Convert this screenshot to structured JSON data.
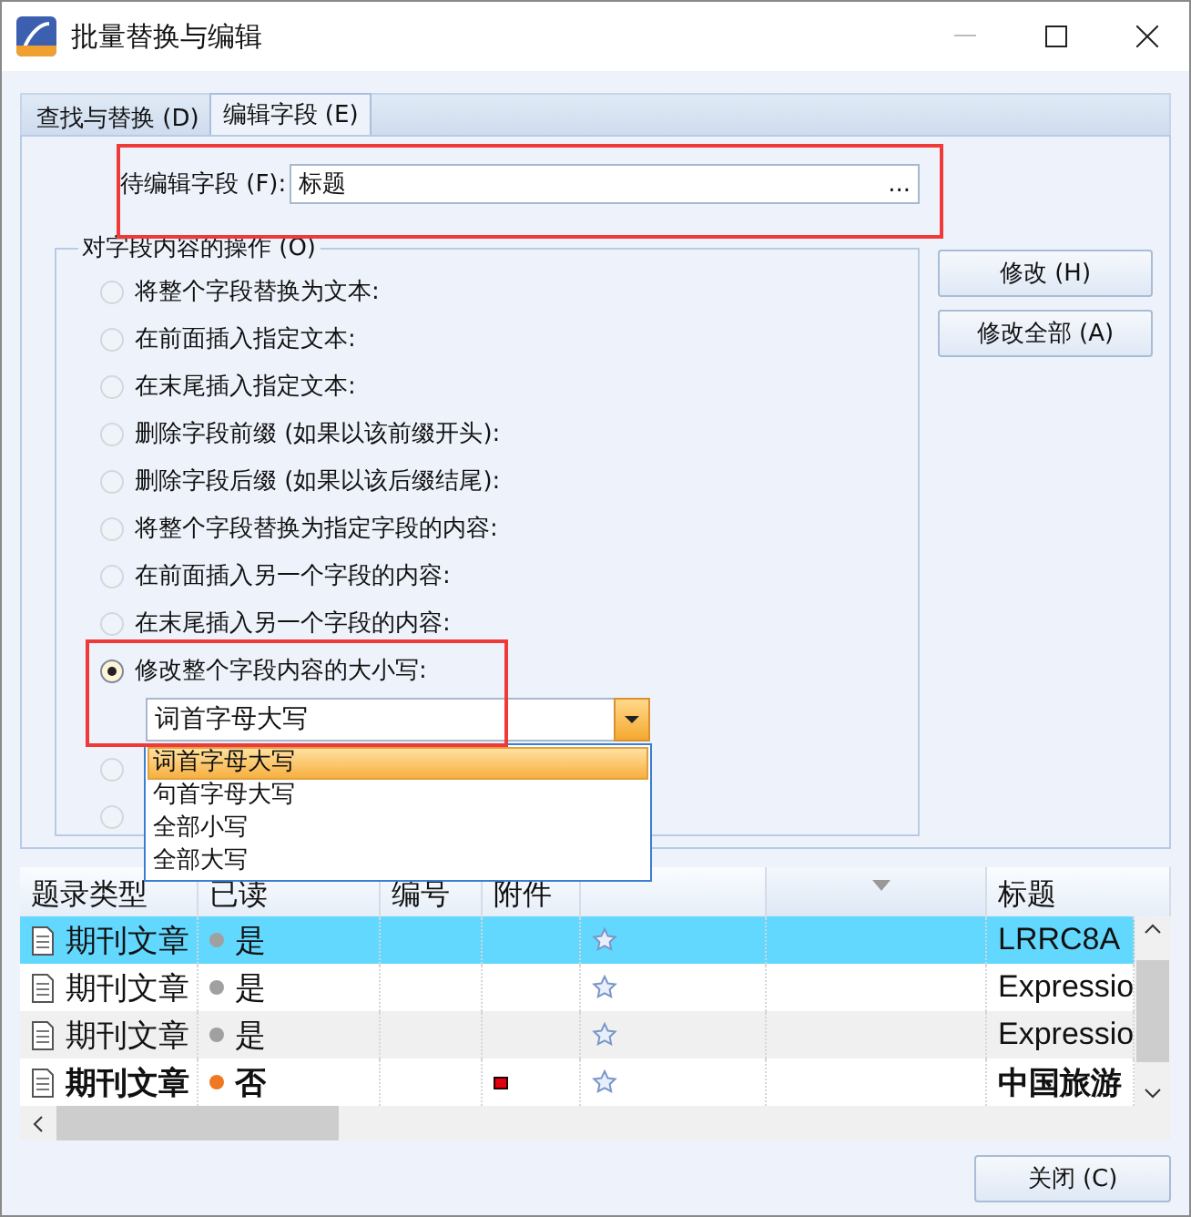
{
  "window": {
    "title": "批量替换与编辑"
  },
  "tabs": [
    {
      "label": "查找与替换 (D)",
      "selected": false
    },
    {
      "label": "编辑字段 (E)",
      "selected": true
    }
  ],
  "field": {
    "label": "待编辑字段 (F):",
    "value": "标题",
    "browse_label": "..."
  },
  "operations": {
    "title": "对字段内容的操作 (O)",
    "options": [
      {
        "label": "将整个字段替换为文本:",
        "selected": false
      },
      {
        "label": "在前面插入指定文本:",
        "selected": false
      },
      {
        "label": "在末尾插入指定文本:",
        "selected": false
      },
      {
        "label": "删除字段前缀 (如果以该前缀开头):",
        "selected": false
      },
      {
        "label": "删除字段后缀 (如果以该后缀结尾):",
        "selected": false
      },
      {
        "label": "将整个字段替换为指定字段的内容:",
        "selected": false
      },
      {
        "label": "在前面插入另一个字段的内容:",
        "selected": false
      },
      {
        "label": "在末尾插入另一个字段的内容:",
        "selected": false
      },
      {
        "label": "修改整个字段内容的大小写:",
        "selected": true
      },
      {
        "selected": false
      },
      {
        "selected": false
      }
    ]
  },
  "case_select": {
    "value": "词首字母大写",
    "expanded": true,
    "options": [
      {
        "label": "词首字母大写",
        "selected": true
      },
      {
        "label": "句首字母大写",
        "selected": false
      },
      {
        "label": "全部小写",
        "selected": false
      },
      {
        "label": "全部大写",
        "selected": false
      }
    ]
  },
  "buttons": [
    "修改 (H)",
    "修改全部 (A)"
  ],
  "table": {
    "columns": [
      {
        "label": "题录类型",
        "sorted": false
      },
      {
        "label": "已读",
        "sorted": false
      },
      {
        "label": "编号",
        "sorted": false
      },
      {
        "label": "附件",
        "sorted": false
      },
      {
        "sorted": false
      },
      {
        "sorted": true
      },
      {
        "label": "标题",
        "sorted": false
      }
    ],
    "rows": [
      {
        "type": "期刊文章",
        "read": "是",
        "color": "#a0a0a0",
        "attachment": false,
        "title": "LRRC8A",
        "selected": true,
        "unread": false
      },
      {
        "type": "期刊文章",
        "read": "是",
        "color": "#a0a0a0",
        "attachment": false,
        "title": "Expressio",
        "selected": false,
        "unread": false
      },
      {
        "type": "期刊文章",
        "read": "是",
        "color": "#a0a0a0",
        "attachment": false,
        "title": "Expressio",
        "selected": false,
        "unread": false
      },
      {
        "type": "期刊文章",
        "read": "否",
        "color": "#f07820",
        "attachment": true,
        "title": "中国旅游",
        "selected": false,
        "unread": true
      }
    ]
  },
  "close_button": "关闭 (C)"
}
